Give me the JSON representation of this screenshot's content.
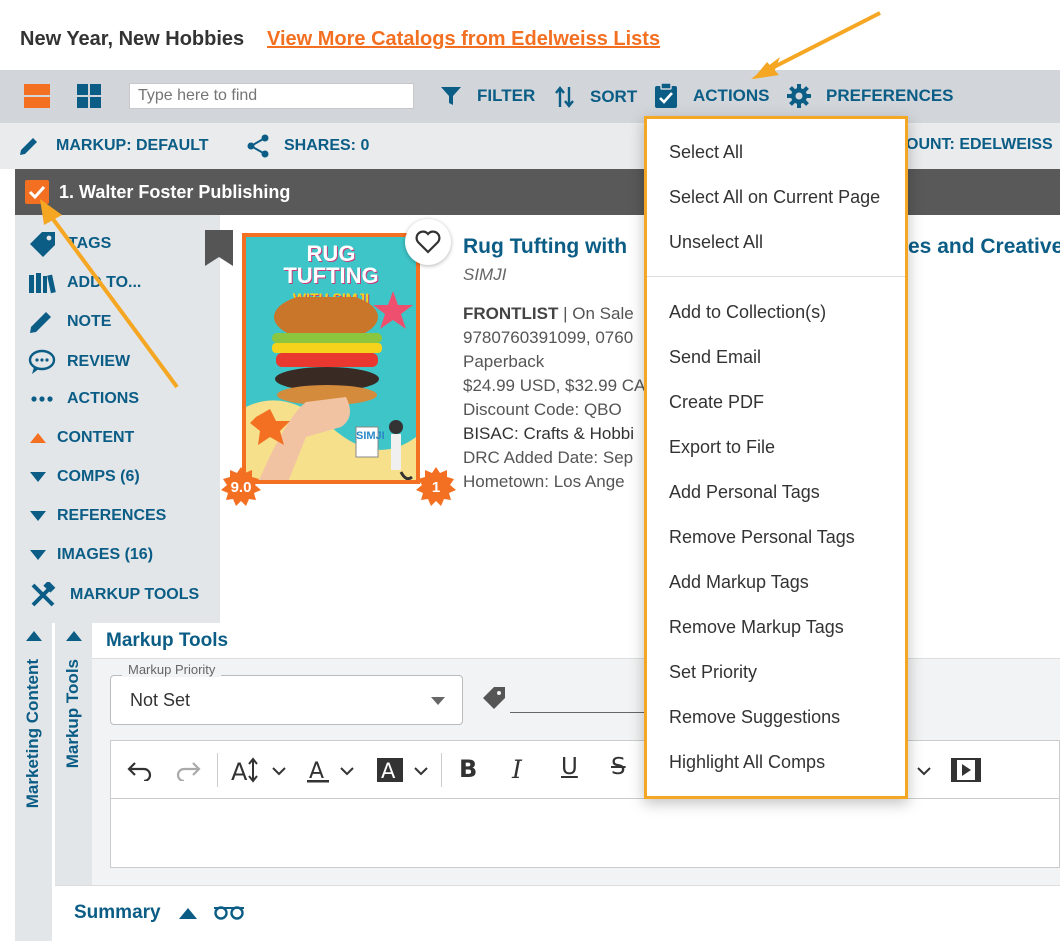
{
  "catalog": {
    "title": "New Year, New Hobbies",
    "link": "View More Catalogs from Edelweiss Lists"
  },
  "toolbar": {
    "search_placeholder": "Type here to find",
    "filter": "FILTER",
    "sort": "SORT",
    "actions": "ACTIONS",
    "preferences": "PREFERENCES"
  },
  "markupbar": {
    "markup": "MARKUP: DEFAULT",
    "shares": "SHARES: 0",
    "account": "OUNT: EDELWEISS"
  },
  "publisher": {
    "name": "1. Walter Foster Publishing"
  },
  "sidebar": {
    "items": [
      {
        "label": "TAGS",
        "icon": "tag-icon"
      },
      {
        "label": "ADD TO...",
        "icon": "books-icon"
      },
      {
        "label": "NOTE",
        "icon": "pencil-icon"
      },
      {
        "label": "REVIEW",
        "icon": "speech-bubble-icon"
      },
      {
        "label": "ACTIONS",
        "icon": "ellipsis-icon"
      },
      {
        "label": "CONTENT",
        "icon": "triangle-up-icon"
      },
      {
        "label": "COMPS (6)",
        "icon": "triangle-down-icon"
      },
      {
        "label": "REFERENCES",
        "icon": "triangle-down-icon"
      },
      {
        "label": "IMAGES (16)",
        "icon": "triangle-down-icon"
      },
      {
        "label": "MARKUP TOOLS",
        "icon": "tools-icon"
      }
    ]
  },
  "book": {
    "cover_line1": "RUG",
    "cover_line2": "TUFTING",
    "cover_line3": "WITH SIMJI",
    "cover_brand": "SIMJI",
    "rating_badge": "9.0",
    "count_badge": "1",
    "title": "Rug Tufting with",
    "title_tail": "es and Creative",
    "author": "SIMJI",
    "list_label": "FRONTLIST",
    "list_rest": " | On Sale",
    "isbn": "9780760391099, 0760",
    "format": "Paperback",
    "price": "$24.99 USD, $32.99 CA",
    "discount": "Discount Code: QBO",
    "bisac": "BISAC: Crafts & Hobbi",
    "drc": "DRC Added Date: Sep",
    "hometown": "Hometown: Los Ange"
  },
  "markup_tools": {
    "marketing_label": "Marketing Content",
    "tools_label": "Markup Tools",
    "header": "Markup Tools",
    "priority_legend": "Markup Priority",
    "priority_value": "Not Set",
    "summary": "Summary"
  },
  "actions_menu": {
    "group1": [
      "Select All",
      "Select All on Current Page",
      "Unselect All"
    ],
    "group2": [
      "Add to Collection(s)",
      "Send Email",
      "Create PDF",
      "Export to File",
      "Add Personal Tags",
      "Remove Personal Tags",
      "Add Markup Tags",
      "Remove Markup Tags",
      "Set Priority",
      "Remove Suggestions",
      "Highlight All Comps"
    ]
  },
  "colors": {
    "brand_blue": "#0b5d86",
    "accent_orange": "#f36f21",
    "annotation_arrow": "#f5a623"
  }
}
